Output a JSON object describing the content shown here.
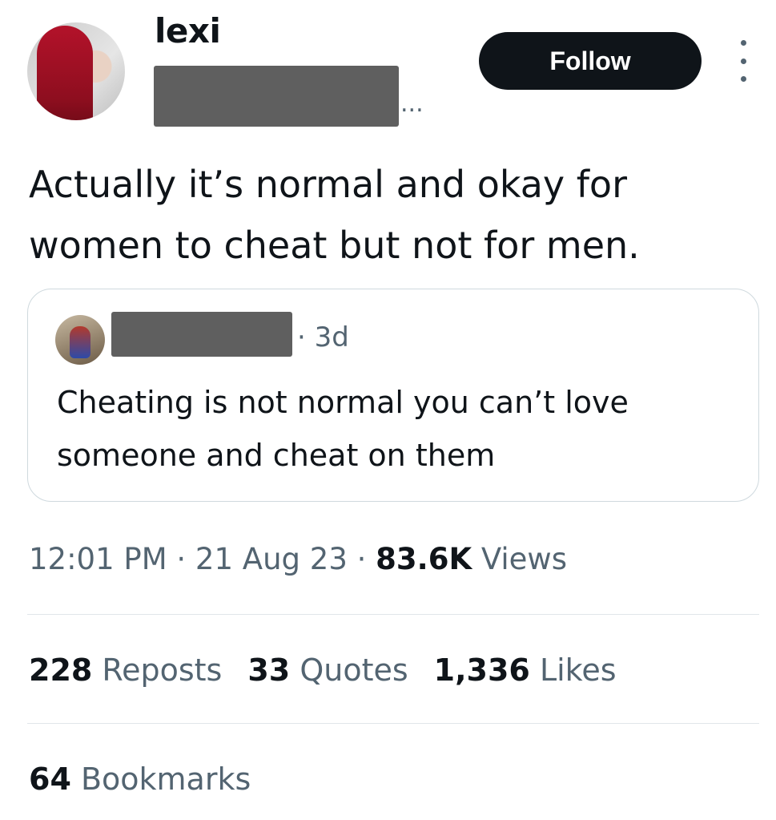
{
  "author": {
    "display_name": "lexi",
    "handle_truncation": "..."
  },
  "header": {
    "follow_label": "Follow",
    "more_icon": "more-dots-vertical-icon"
  },
  "tweet": {
    "text": "Actually it’s normal and okay for women to cheat but not for men."
  },
  "quoted_tweet": {
    "time": "· 3d",
    "text": "Cheating is not normal you can’t love someone and cheat on them"
  },
  "meta": {
    "time": "12:01 PM",
    "sep1": " · ",
    "date": "21 Aug 23",
    "sep2": " · ",
    "views_count": "83.6K",
    "views_label": " Views"
  },
  "stats": {
    "reposts_count": "228",
    "reposts_label": " Reposts",
    "quotes_count": "33",
    "quotes_label": " Quotes",
    "likes_count": "1,336",
    "likes_label": " Likes",
    "bookmarks_count": "64",
    "bookmarks_label": " Bookmarks"
  },
  "colors": {
    "text_primary": "#0f1419",
    "text_secondary": "#536471",
    "follow_bg": "#0f1419",
    "border": "#cfd9de"
  }
}
